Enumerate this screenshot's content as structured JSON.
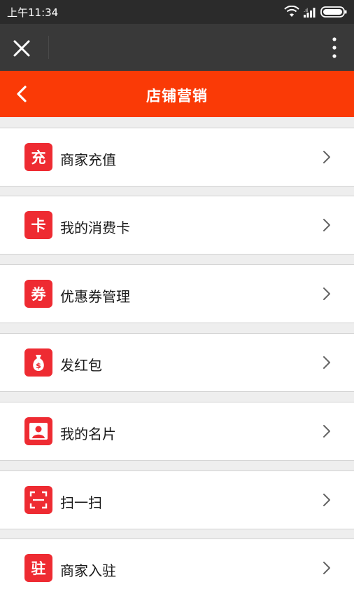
{
  "status_bar": {
    "time": "上午11:34",
    "icons": [
      "wifi-icon",
      "signal-icon",
      "battery-icon"
    ]
  },
  "web_toolbar": {
    "icons": [
      "close-icon",
      "more-vertical-icon"
    ]
  },
  "header": {
    "title": "店铺营销",
    "back_icon": "chevron-left-icon",
    "color": "#fa3a06"
  },
  "menu": {
    "icon_color": "#ee2b32",
    "items": [
      {
        "label": "商家充值",
        "icon_glyph": "充",
        "icon": "recharge-icon"
      },
      {
        "label": "我的消费卡",
        "icon_glyph": "卡",
        "icon": "card-icon"
      },
      {
        "label": "优惠券管理",
        "icon_glyph": "券",
        "icon": "coupon-icon"
      },
      {
        "label": "发红包",
        "icon_glyph": "",
        "icon": "money-bag-icon"
      },
      {
        "label": "我的名片",
        "icon_glyph": "",
        "icon": "user-card-icon"
      },
      {
        "label": "扫一扫",
        "icon_glyph": "",
        "icon": "scan-icon"
      },
      {
        "label": "商家入驻",
        "icon_glyph": "驻",
        "icon": "settle-in-icon"
      }
    ]
  }
}
